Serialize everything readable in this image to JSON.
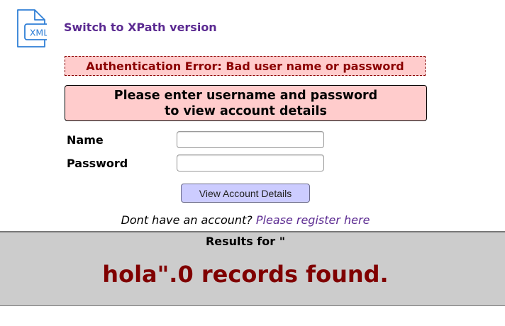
{
  "header": {
    "icon_label": "XML",
    "xpath_link": "Switch to XPath version"
  },
  "error": {
    "message": "Authentication Error: Bad user name or password"
  },
  "prompt": {
    "line1": "Please enter username and password",
    "line2": "to view account details"
  },
  "form": {
    "name_label": "Name",
    "name_value": "",
    "password_label": "Password",
    "password_value": "",
    "submit_label": "View Account Details"
  },
  "register": {
    "prefix": "Dont have an account?",
    "link_text": "Please register here"
  },
  "results": {
    "header": "Results for \"",
    "summary": "hola\".0 records found."
  },
  "colors": {
    "link": "#5b2a91",
    "error_text": "#8b0000",
    "error_bg": "#ffcccc",
    "button_bg": "#ccccff",
    "results_bg": "#cccccc",
    "results_text": "#800000",
    "icon_blue": "#2f7fd6"
  }
}
